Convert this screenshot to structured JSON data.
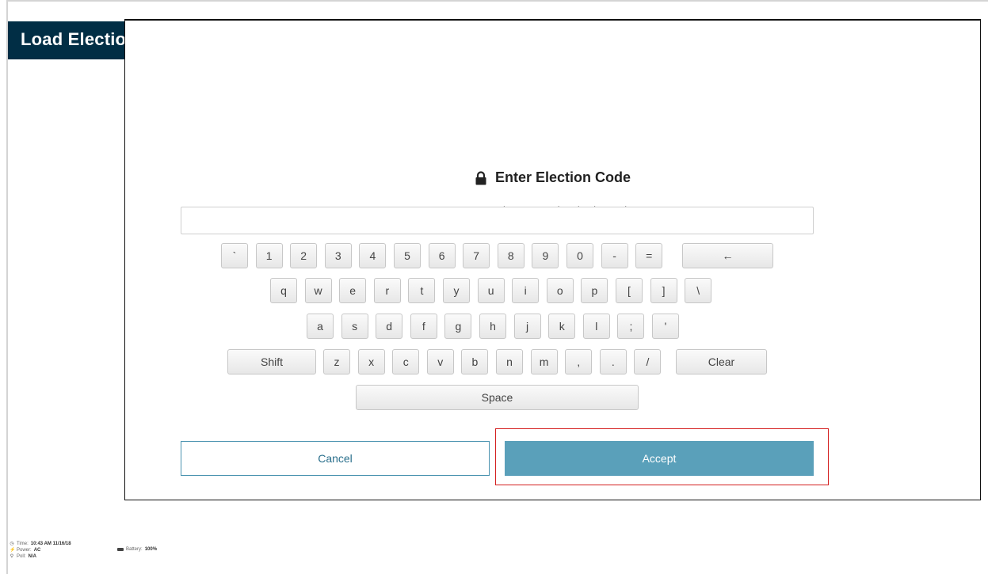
{
  "header": {
    "title": "Load Election"
  },
  "dialog": {
    "title": "Enter Election Code",
    "subtitle": "To continue, enter the election code.",
    "input_value": "",
    "input_placeholder": "",
    "lock_icon": "lock-icon"
  },
  "keyboard": {
    "row1": [
      "`",
      "1",
      "2",
      "3",
      "4",
      "5",
      "6",
      "7",
      "8",
      "9",
      "0",
      "-",
      "=",
      "←"
    ],
    "row2": [
      "q",
      "w",
      "e",
      "r",
      "t",
      "y",
      "u",
      "i",
      "o",
      "p",
      "[",
      "]",
      "\\"
    ],
    "row3": [
      "a",
      "s",
      "d",
      "f",
      "g",
      "h",
      "j",
      "k",
      "l",
      ";",
      "'"
    ],
    "row4": [
      "Shift",
      "z",
      "x",
      "c",
      "v",
      "b",
      "n",
      "m",
      ",",
      ".",
      "/",
      "Clear"
    ],
    "row5": [
      "Space"
    ]
  },
  "buttons": {
    "cancel_label": "Cancel",
    "accept_label": "Accept"
  },
  "status": {
    "time_label": "Time:",
    "time_value": "10:43 AM 11/16/18",
    "power_label": "Power:",
    "power_value": "AC",
    "poll_label": "Poll:",
    "poll_value": "N/A",
    "battery_label": "Battery:",
    "battery_value": "100%"
  },
  "colors": {
    "header_bg": "#012e45",
    "accept_bg": "#5aa0ba",
    "cancel_border": "#4a93b0",
    "highlight": "#d42020"
  }
}
